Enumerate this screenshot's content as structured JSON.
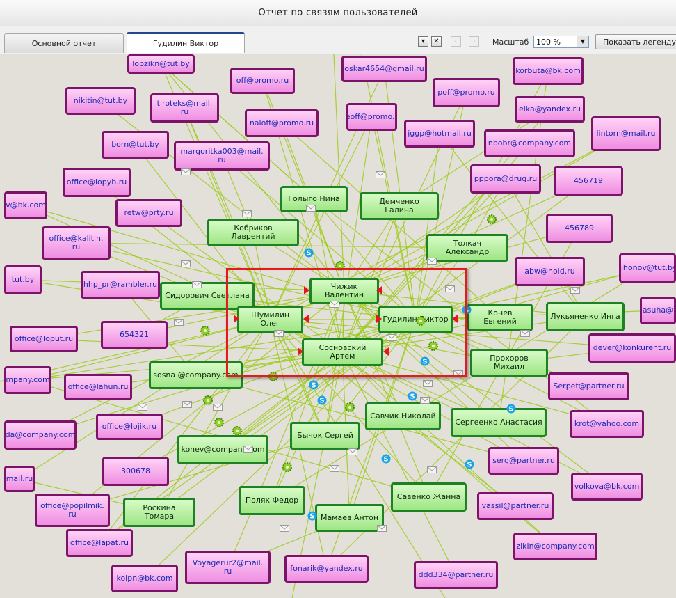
{
  "window": {
    "title": "Отчет по связям пользователей"
  },
  "tabs": [
    {
      "label": "Основной отчет",
      "active": false
    },
    {
      "label": "Гудилин Виктор",
      "active": true
    }
  ],
  "toolbar": {
    "dropdown_icon": "chevron-down-icon",
    "close_icon": "close-icon",
    "back_icon": "arrow-left-icon",
    "forward_icon": "arrow-right-icon",
    "scale_label": "Масштаб",
    "scale_value": "100 %",
    "legend_button": "Показать легенду"
  },
  "colors": {
    "canvas_bg": "#e3e0d9",
    "edge": "#9ccc1c",
    "email_border": "#7b1468",
    "email_fill": "#ef8ee2",
    "email_text": "#1a2ab3",
    "person_border": "#1d8221",
    "person_fill": "#9fe685",
    "selection": "#e41b1b",
    "arrow": "#e8151a"
  },
  "graph": {
    "email_nodes": [
      "lobzikn@tut.by",
      "oskar4654@gmail.ru",
      "korbuta@bk.com",
      "off@promo.ru",
      "nikitin@tut.by",
      "tiroteks@mail.\nru",
      "poff@promo.ru",
      "elka@yandex.ru",
      "naloff@promo.ru",
      "eeoff@promo.ru",
      "jggp@hotmail.ru",
      "nbobr@company.com",
      "lintorn@mail.ru",
      "born@tut.by",
      "margoritka003@mail.\nru",
      "pppora@drug.ru",
      "456719",
      "office@lopyb.ru",
      "v@bk.com",
      "retw@prty.ru",
      "456789",
      "office@kalitin.\nru",
      "abw@hold.ru",
      "tihonov@tut.by",
      "tut.by",
      "hhp_pr@rambler.ru",
      "asuha@",
      "office@loput.ru",
      "654321",
      "dever@konkurent.ru",
      "mpany.com",
      "office@lahun.ru",
      "Serpet@partner.ru",
      "da@company.com",
      "office@lojik.ru",
      "krot@yahoo.com",
      "serg@partner.ru",
      "mail.ru",
      "300678",
      "volkova@bk.com",
      "office@popilmik.\nru",
      "vassil@partner.ru",
      "office@lapat.ru",
      "zikin@company.com",
      "Voyagerur2@mail.\nru",
      "fonarik@yandex.ru",
      "kolpn@bk.com",
      "ddd334@partner.ru"
    ],
    "person_nodes": [
      "Голыго Нина",
      "Демченко Галина",
      "Кобриков Лаврентий",
      "Толкач Александр",
      "Сидорович Светлана",
      "Чижик Валентин",
      "Шумилин Олег",
      "Гудилин Виктор",
      "Конев Евгений",
      "Лукьяненко Инга",
      "Сосновский Артем",
      "Прохоров Михаил",
      "sosna @company.com",
      "Савчик Николай",
      "Сергеенко Анастасия",
      "Бычок Сергей",
      "konev@company.com",
      "Поляк Федор",
      "Савенко Жанна",
      "Роскина Томара",
      "Мамаев Антон"
    ],
    "icon_types": [
      "envelope-icon",
      "skype-icon",
      "gear-icon"
    ]
  }
}
